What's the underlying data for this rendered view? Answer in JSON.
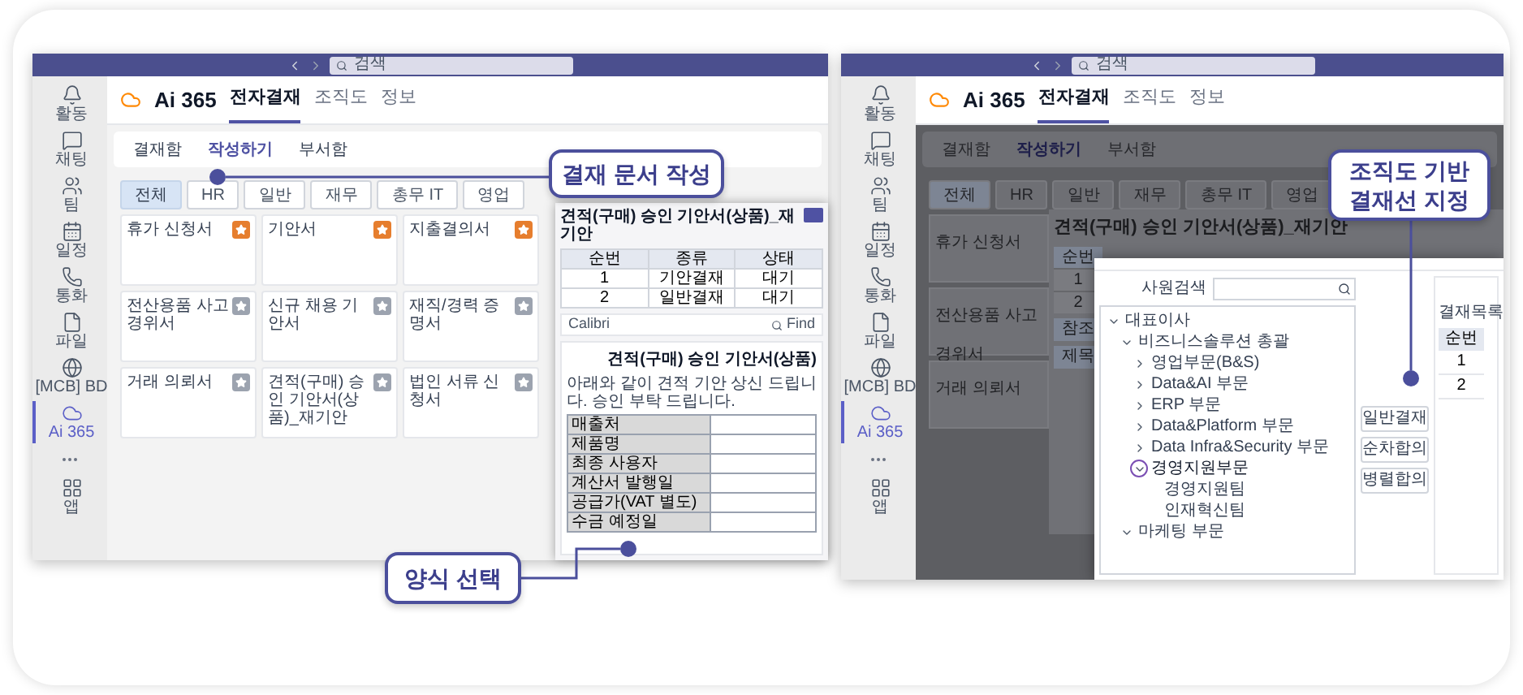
{
  "left_window": {
    "search": {
      "placeholder": "검색"
    },
    "rail": [
      {
        "label": "활동",
        "selected": false
      },
      {
        "label": "채팅",
        "selected": false
      },
      {
        "label": "팀",
        "selected": false
      },
      {
        "label": "일정",
        "selected": false
      },
      {
        "label": "통화",
        "selected": false
      },
      {
        "label": "파일",
        "selected": false
      },
      {
        "label": "[MCB] BD",
        "selected": false
      },
      {
        "label": "Ai 365",
        "selected": true
      },
      {
        "label": "앱",
        "selected": false
      }
    ],
    "app_name": "Ai 365",
    "nav_tabs": [
      {
        "label": "전자결재",
        "selected": true
      },
      {
        "label": "조직도",
        "selected": false
      },
      {
        "label": "정보",
        "selected": false
      }
    ],
    "sub_tabs": [
      {
        "label": "결재함",
        "selected": false
      },
      {
        "label": "작성하기",
        "selected": true
      },
      {
        "label": "부서함",
        "selected": false
      }
    ],
    "categories": [
      {
        "label": "전체",
        "selected": true
      },
      {
        "label": "HR",
        "selected": false
      },
      {
        "label": "일반",
        "selected": false
      },
      {
        "label": "재무",
        "selected": false
      },
      {
        "label": "총무 IT",
        "selected": false
      },
      {
        "label": "영업",
        "selected": false
      }
    ],
    "forms": [
      {
        "name": "휴가 신청서",
        "starred": true
      },
      {
        "name": "기안서",
        "starred": true
      },
      {
        "name": "지출결의서",
        "starred": true
      },
      {
        "name": "전산용품 사고 경위서",
        "starred": false
      },
      {
        "name": "신규 채용 기안서",
        "starred": false
      },
      {
        "name": "재직/경력 증명서",
        "starred": false
      },
      {
        "name": "거래 의뢰서",
        "starred": false
      },
      {
        "name": "견적(구매) 승인 기안서(상품)_재기안",
        "starred": false
      },
      {
        "name": "법인 서류 신청서",
        "starred": false
      }
    ],
    "document_window": {
      "title": "견적(구매) 승인 기안서(상품)_재기안",
      "approval_table": {
        "columns": [
          "순번",
          "종류",
          "상태"
        ],
        "rows": [
          [
            "1",
            "기안결재",
            "대기"
          ],
          [
            "2",
            "일반결재",
            "대기"
          ]
        ]
      },
      "toolbar": {
        "font": "Calibri",
        "find": "Find"
      },
      "heading": "견적(구매) 승인 기안서(상품)",
      "intro": "아래와 같이 견적 기안 상신 드립니다. 승인 부탁 드립니다.",
      "fields": [
        "매출처",
        "제품명",
        "최종 사용자",
        "계산서 발행일",
        "공급가(VAT 별도)",
        "수금 예정일"
      ]
    }
  },
  "right_window": {
    "search": {
      "placeholder": "검색"
    },
    "rail": [
      {
        "label": "활동",
        "selected": false
      },
      {
        "label": "채팅",
        "selected": false
      },
      {
        "label": "팀",
        "selected": false
      },
      {
        "label": "일정",
        "selected": false
      },
      {
        "label": "통화",
        "selected": false
      },
      {
        "label": "파일",
        "selected": false
      },
      {
        "label": "[MCB] BD",
        "selected": false
      },
      {
        "label": "Ai 365",
        "selected": true
      },
      {
        "label": "앱",
        "selected": false
      }
    ],
    "app_name": "Ai 365",
    "nav_tabs": [
      {
        "label": "전자결재",
        "selected": true
      },
      {
        "label": "조직도",
        "selected": false
      },
      {
        "label": "정보",
        "selected": false
      }
    ],
    "sub_tabs": [
      {
        "label": "결재함",
        "selected": false
      },
      {
        "label": "작성하기",
        "selected": true
      },
      {
        "label": "부서함",
        "selected": false
      }
    ],
    "categories": [
      {
        "label": "전체",
        "selected": true
      },
      {
        "label": "HR",
        "selected": false
      },
      {
        "label": "일반",
        "selected": false
      },
      {
        "label": "재무",
        "selected": false
      },
      {
        "label": "총무 IT",
        "selected": false
      },
      {
        "label": "영업",
        "selected": false
      }
    ],
    "forms": [
      "휴가 신청서",
      "전산용품 사고 경위서",
      "거래 의뢰서"
    ],
    "document_window": {
      "title": "견적(구매) 승인 기안서(상품)_재기안",
      "column": "순번",
      "rows": [
        "1",
        "2"
      ],
      "fields": [
        "참조",
        "제목"
      ]
    },
    "org_dialog": {
      "search_label": "사원검색",
      "tree": [
        {
          "label": "대표이사",
          "expanded": true,
          "highlighted": false,
          "children": [
            {
              "label": "비즈니스솔루션 총괄",
              "expanded": true,
              "highlighted": false,
              "children": [
                {
                  "label": "영업부문(B&S)",
                  "expanded": false,
                  "highlighted": false
                },
                {
                  "label": "Data&AI 부문",
                  "expanded": false,
                  "highlighted": false
                },
                {
                  "label": "ERP 부문",
                  "expanded": false,
                  "highlighted": false
                },
                {
                  "label": "Data&Platform 부문",
                  "expanded": false,
                  "highlighted": false
                },
                {
                  "label": "Data Infra&Security 부문",
                  "expanded": false,
                  "highlighted": false
                },
                {
                  "label": "경영지원부문",
                  "expanded": true,
                  "highlighted": true,
                  "children": [
                    {
                      "label": "경영지원팀",
                      "highlighted": false
                    },
                    {
                      "label": "인재혁신팀",
                      "highlighted": false
                    }
                  ]
                }
              ]
            },
            {
              "label": "마케팅 부문",
              "expanded": true,
              "highlighted": false
            }
          ]
        }
      ],
      "buttons": [
        "일반결재",
        "순차합의",
        "병렬합의"
      ],
      "list_title": "결재목록",
      "list_column": "순번",
      "list_rows": [
        "1",
        "2"
      ]
    }
  },
  "callouts": [
    {
      "lines": [
        "결재 문서 작성"
      ]
    },
    {
      "lines": [
        "양식 선택"
      ]
    },
    {
      "lines": [
        "조직도 기반",
        "결재선 지정"
      ]
    }
  ]
}
